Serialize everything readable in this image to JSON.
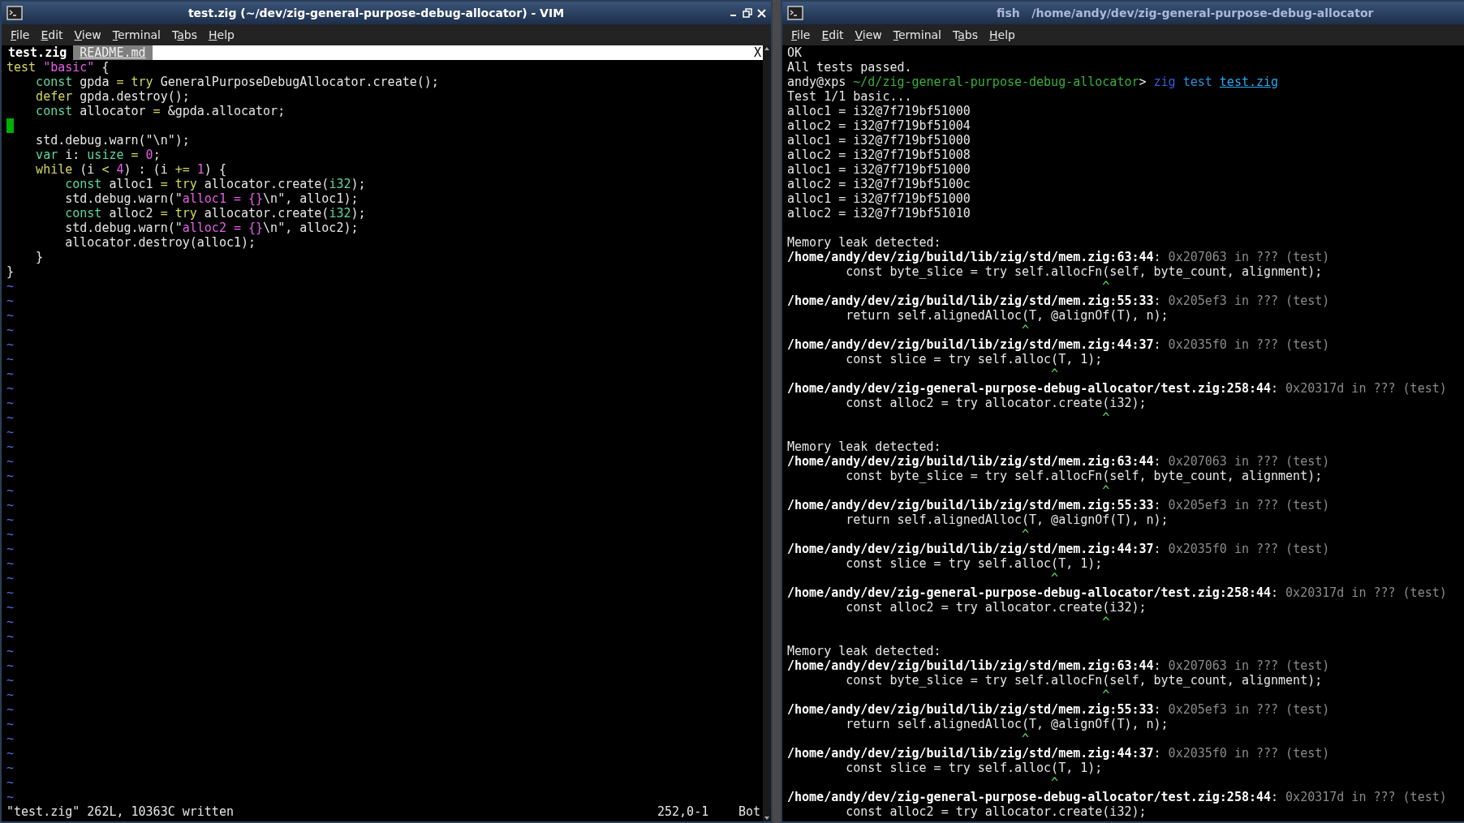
{
  "vim_window": {
    "title": "test.zig (~/dev/zig-general-purpose-debug-allocator) - VIM",
    "menu": [
      {
        "key": "F",
        "post": "ile"
      },
      {
        "key": "E",
        "post": "dit"
      },
      {
        "key": "V",
        "post": "iew"
      },
      {
        "key": "T",
        "post": "erminal"
      },
      {
        "pre": "T",
        "key": "a",
        "post": "bs"
      },
      {
        "key": "H",
        "post": "elp"
      }
    ],
    "tabs": [
      {
        "label": "test.zig",
        "selected": true
      },
      {
        "label": "README.md",
        "selected": false
      }
    ],
    "close_tab": "X",
    "lines": [
      {
        "kind": "text",
        "segs": [
          {
            "t": "test",
            "kind": "kw"
          },
          {
            "t": " \"basic\"",
            "kind": "lit"
          },
          {
            "t": " {",
            "kind": "plain"
          }
        ]
      },
      {
        "kind": "text",
        "segs": [
          {
            "t": "    const",
            "kind": "decl"
          },
          {
            "t": " gpda",
            "kind": "plain"
          },
          {
            "t": " =",
            "kind": "kw"
          },
          {
            "t": " try",
            "kind": "kw"
          },
          {
            "t": " GeneralPurposeDebugAllocator.create();",
            "kind": "plain"
          }
        ]
      },
      {
        "kind": "text",
        "segs": [
          {
            "t": "    defer",
            "kind": "kw"
          },
          {
            "t": " gpda.destroy();",
            "kind": "plain"
          }
        ]
      },
      {
        "kind": "text",
        "segs": [
          {
            "t": "    const",
            "kind": "decl"
          },
          {
            "t": " allocator",
            "kind": "plain"
          },
          {
            "t": " =",
            "kind": "kw"
          },
          {
            "t": " &gpda.allocator;",
            "kind": "plain"
          }
        ]
      },
      {
        "kind": "cursor"
      },
      {
        "kind": "text",
        "segs": [
          {
            "t": "    std.debug.warn(\"\\n\");",
            "kind": "plain"
          }
        ]
      },
      {
        "kind": "text",
        "segs": [
          {
            "t": "    var",
            "kind": "decl"
          },
          {
            "t": " i:",
            "kind": "plain"
          },
          {
            "t": " usize",
            "kind": "decl"
          },
          {
            "t": " =",
            "kind": "kw"
          },
          {
            "t": " 0",
            "kind": "lit"
          },
          {
            "t": ";",
            "kind": "plain"
          }
        ]
      },
      {
        "kind": "text",
        "segs": [
          {
            "t": "    while",
            "kind": "kw"
          },
          {
            "t": " (i",
            "kind": "plain"
          },
          {
            "t": " <",
            "kind": "kw"
          },
          {
            "t": " 4",
            "kind": "lit"
          },
          {
            "t": ") : (i",
            "kind": "plain"
          },
          {
            "t": " +=",
            "kind": "kw"
          },
          {
            "t": " 1",
            "kind": "lit"
          },
          {
            "t": ") {",
            "kind": "plain"
          }
        ]
      },
      {
        "kind": "text",
        "segs": [
          {
            "t": "        const",
            "kind": "decl"
          },
          {
            "t": " alloc1",
            "kind": "plain"
          },
          {
            "t": " =",
            "kind": "kw"
          },
          {
            "t": " try",
            "kind": "kw"
          },
          {
            "t": " allocator.create(",
            "kind": "plain"
          },
          {
            "t": "i32",
            "kind": "decl"
          },
          {
            "t": ");",
            "kind": "plain"
          }
        ]
      },
      {
        "kind": "text",
        "segs": [
          {
            "t": "        std.debug.warn(\"",
            "kind": "plain"
          },
          {
            "t": "alloc1 = {}",
            "kind": "lit"
          },
          {
            "t": "\\n\", alloc1);",
            "kind": "plain"
          }
        ]
      },
      {
        "kind": "text",
        "segs": [
          {
            "t": "        const",
            "kind": "decl"
          },
          {
            "t": " alloc2",
            "kind": "plain"
          },
          {
            "t": " =",
            "kind": "kw"
          },
          {
            "t": " try",
            "kind": "kw"
          },
          {
            "t": " allocator.create(",
            "kind": "plain"
          },
          {
            "t": "i32",
            "kind": "decl"
          },
          {
            "t": ");",
            "kind": "plain"
          }
        ]
      },
      {
        "kind": "text",
        "segs": [
          {
            "t": "        std.debug.warn(\"",
            "kind": "plain"
          },
          {
            "t": "alloc2 = {}",
            "kind": "lit"
          },
          {
            "t": "\\n\", alloc2);",
            "kind": "plain"
          }
        ]
      },
      {
        "kind": "text",
        "segs": [
          {
            "t": "        allocator.destroy(alloc1);",
            "kind": "plain"
          }
        ]
      },
      {
        "kind": "text",
        "segs": [
          {
            "t": "    }",
            "kind": "plain"
          }
        ]
      },
      {
        "kind": "text",
        "segs": [
          {
            "t": "}",
            "kind": "plain"
          }
        ]
      }
    ],
    "tildes": [
      "~",
      "~",
      "~",
      "~",
      "~",
      "~",
      "~",
      "~",
      "~",
      "~",
      "~",
      "~",
      "~",
      "~",
      "~",
      "~",
      "~",
      "~",
      "~",
      "~",
      "~",
      "~",
      "~",
      "~",
      "~",
      "~",
      "~",
      "~",
      "~",
      "~",
      "~",
      "~",
      "~",
      "~",
      "~",
      "~"
    ],
    "status": {
      "message": "\"test.zig\" 262L, 10363C written",
      "position": "252,0-1",
      "scroll": "Bot"
    }
  },
  "terminal_window": {
    "title": "fish   /home/andy/dev/zig-general-purpose-debug-allocator",
    "menu": [
      {
        "key": "F",
        "post": "ile"
      },
      {
        "key": "E",
        "post": "dit"
      },
      {
        "key": "V",
        "post": "iew"
      },
      {
        "key": "T",
        "post": "erminal"
      },
      {
        "pre": "T",
        "key": "a",
        "post": "bs"
      },
      {
        "key": "H",
        "post": "elp"
      }
    ],
    "lines": [
      {
        "kind": "text",
        "segs": [
          {
            "t": "OK",
            "kind": "plain"
          }
        ]
      },
      {
        "kind": "text",
        "segs": [
          {
            "t": "All tests passed.",
            "kind": "plain"
          }
        ]
      },
      {
        "kind": "text",
        "segs": [
          {
            "t": "andy@xps",
            "kind": "plain"
          },
          {
            "t": " ~/d/zig-general-purpose-debug-allocator",
            "kind": "green"
          },
          {
            "t": ">",
            "kind": "plain"
          },
          {
            "t": " zig",
            "kind": "blue"
          },
          {
            "t": " test ",
            "kind": "cyan"
          },
          {
            "t": "test.zig",
            "kind": "link"
          }
        ]
      },
      {
        "kind": "text",
        "segs": [
          {
            "t": "Test 1/1 basic...",
            "kind": "plain"
          }
        ]
      },
      {
        "kind": "text",
        "segs": [
          {
            "t": "alloc1 = i32@7f719bf51000",
            "kind": "plain"
          }
        ]
      },
      {
        "kind": "text",
        "segs": [
          {
            "t": "alloc2 = i32@7f719bf51004",
            "kind": "plain"
          }
        ]
      },
      {
        "kind": "text",
        "segs": [
          {
            "t": "alloc1 = i32@7f719bf51000",
            "kind": "plain"
          }
        ]
      },
      {
        "kind": "text",
        "segs": [
          {
            "t": "alloc2 = i32@7f719bf51008",
            "kind": "plain"
          }
        ]
      },
      {
        "kind": "text",
        "segs": [
          {
            "t": "alloc1 = i32@7f719bf51000",
            "kind": "plain"
          }
        ]
      },
      {
        "kind": "text",
        "segs": [
          {
            "t": "alloc2 = i32@7f719bf5100c",
            "kind": "plain"
          }
        ]
      },
      {
        "kind": "text",
        "segs": [
          {
            "t": "alloc1 = i32@7f719bf51000",
            "kind": "plain"
          }
        ]
      },
      {
        "kind": "text",
        "segs": [
          {
            "t": "alloc2 = i32@7f719bf51010",
            "kind": "plain"
          }
        ]
      },
      {
        "kind": "blank"
      },
      {
        "kind": "text",
        "segs": [
          {
            "t": "Memory leak detected:",
            "kind": "plain"
          }
        ]
      },
      {
        "kind": "text",
        "segs": [
          {
            "t": "/home/andy/dev/zig/build/lib/zig/std/mem.zig:63:44",
            "kind": "bold"
          },
          {
            "t": ":",
            "kind": "plain"
          },
          {
            "t": " 0x207063 in ??? (test)",
            "kind": "dim"
          }
        ]
      },
      {
        "kind": "text",
        "segs": [
          {
            "t": "        const byte_slice = try self.allocFn(self, byte_count, alignment);",
            "kind": "plain"
          }
        ]
      },
      {
        "kind": "text",
        "segs": [
          {
            "t": "                                           ^",
            "kind": "caret"
          }
        ]
      },
      {
        "kind": "text",
        "segs": [
          {
            "t": "/home/andy/dev/zig/build/lib/zig/std/mem.zig:55:33",
            "kind": "bold"
          },
          {
            "t": ":",
            "kind": "plain"
          },
          {
            "t": " 0x205ef3 in ??? (test)",
            "kind": "dim"
          }
        ]
      },
      {
        "kind": "text",
        "segs": [
          {
            "t": "        return self.alignedAlloc(T, @alignOf(T), n);",
            "kind": "plain"
          }
        ]
      },
      {
        "kind": "text",
        "segs": [
          {
            "t": "                                ^",
            "kind": "caret"
          }
        ]
      },
      {
        "kind": "text",
        "segs": [
          {
            "t": "/home/andy/dev/zig/build/lib/zig/std/mem.zig:44:37",
            "kind": "bold"
          },
          {
            "t": ":",
            "kind": "plain"
          },
          {
            "t": " 0x2035f0 in ??? (test)",
            "kind": "dim"
          }
        ]
      },
      {
        "kind": "text",
        "segs": [
          {
            "t": "        const slice = try self.alloc(T, 1);",
            "kind": "plain"
          }
        ]
      },
      {
        "kind": "text",
        "segs": [
          {
            "t": "                                    ^",
            "kind": "caret"
          }
        ]
      },
      {
        "kind": "text",
        "segs": [
          {
            "t": "/home/andy/dev/zig-general-purpose-debug-allocator/test.zig:258:44",
            "kind": "bold"
          },
          {
            "t": ":",
            "kind": "plain"
          },
          {
            "t": " 0x20317d in ??? (test)",
            "kind": "dim"
          }
        ]
      },
      {
        "kind": "text",
        "segs": [
          {
            "t": "        const alloc2 = try allocator.create(i32);",
            "kind": "plain"
          }
        ]
      },
      {
        "kind": "text",
        "segs": [
          {
            "t": "                                           ^",
            "kind": "caret"
          }
        ]
      },
      {
        "kind": "blank"
      },
      {
        "kind": "text",
        "segs": [
          {
            "t": "Memory leak detected:",
            "kind": "plain"
          }
        ]
      },
      {
        "kind": "text",
        "segs": [
          {
            "t": "/home/andy/dev/zig/build/lib/zig/std/mem.zig:63:44",
            "kind": "bold"
          },
          {
            "t": ":",
            "kind": "plain"
          },
          {
            "t": " 0x207063 in ??? (test)",
            "kind": "dim"
          }
        ]
      },
      {
        "kind": "text",
        "segs": [
          {
            "t": "        const byte_slice = try self.allocFn(self, byte_count, alignment);",
            "kind": "plain"
          }
        ]
      },
      {
        "kind": "text",
        "segs": [
          {
            "t": "                                           ^",
            "kind": "caret"
          }
        ]
      },
      {
        "kind": "text",
        "segs": [
          {
            "t": "/home/andy/dev/zig/build/lib/zig/std/mem.zig:55:33",
            "kind": "bold"
          },
          {
            "t": ":",
            "kind": "plain"
          },
          {
            "t": " 0x205ef3 in ??? (test)",
            "kind": "dim"
          }
        ]
      },
      {
        "kind": "text",
        "segs": [
          {
            "t": "        return self.alignedAlloc(T, @alignOf(T), n);",
            "kind": "plain"
          }
        ]
      },
      {
        "kind": "text",
        "segs": [
          {
            "t": "                                ^",
            "kind": "caret"
          }
        ]
      },
      {
        "kind": "text",
        "segs": [
          {
            "t": "/home/andy/dev/zig/build/lib/zig/std/mem.zig:44:37",
            "kind": "bold"
          },
          {
            "t": ":",
            "kind": "plain"
          },
          {
            "t": " 0x2035f0 in ??? (test)",
            "kind": "dim"
          }
        ]
      },
      {
        "kind": "text",
        "segs": [
          {
            "t": "        const slice = try self.alloc(T, 1);",
            "kind": "plain"
          }
        ]
      },
      {
        "kind": "text",
        "segs": [
          {
            "t": "                                    ^",
            "kind": "caret"
          }
        ]
      },
      {
        "kind": "text",
        "segs": [
          {
            "t": "/home/andy/dev/zig-general-purpose-debug-allocator/test.zig:258:44",
            "kind": "bold"
          },
          {
            "t": ":",
            "kind": "plain"
          },
          {
            "t": " 0x20317d in ??? (test)",
            "kind": "dim"
          }
        ]
      },
      {
        "kind": "text",
        "segs": [
          {
            "t": "        const alloc2 = try allocator.create(i32);",
            "kind": "plain"
          }
        ]
      },
      {
        "kind": "text",
        "segs": [
          {
            "t": "                                           ^",
            "kind": "caret"
          }
        ]
      },
      {
        "kind": "blank"
      },
      {
        "kind": "text",
        "segs": [
          {
            "t": "Memory leak detected:",
            "kind": "plain"
          }
        ]
      },
      {
        "kind": "text",
        "segs": [
          {
            "t": "/home/andy/dev/zig/build/lib/zig/std/mem.zig:63:44",
            "kind": "bold"
          },
          {
            "t": ":",
            "kind": "plain"
          },
          {
            "t": " 0x207063 in ??? (test)",
            "kind": "dim"
          }
        ]
      },
      {
        "kind": "text",
        "segs": [
          {
            "t": "        const byte_slice = try self.allocFn(self, byte_count, alignment);",
            "kind": "plain"
          }
        ]
      },
      {
        "kind": "text",
        "segs": [
          {
            "t": "                                           ^",
            "kind": "caret"
          }
        ]
      },
      {
        "kind": "text",
        "segs": [
          {
            "t": "/home/andy/dev/zig/build/lib/zig/std/mem.zig:55:33",
            "kind": "bold"
          },
          {
            "t": ":",
            "kind": "plain"
          },
          {
            "t": " 0x205ef3 in ??? (test)",
            "kind": "dim"
          }
        ]
      },
      {
        "kind": "text",
        "segs": [
          {
            "t": "        return self.alignedAlloc(T, @alignOf(T), n);",
            "kind": "plain"
          }
        ]
      },
      {
        "kind": "text",
        "segs": [
          {
            "t": "                                ^",
            "kind": "caret"
          }
        ]
      },
      {
        "kind": "text",
        "segs": [
          {
            "t": "/home/andy/dev/zig/build/lib/zig/std/mem.zig:44:37",
            "kind": "bold"
          },
          {
            "t": ":",
            "kind": "plain"
          },
          {
            "t": " 0x2035f0 in ??? (test)",
            "kind": "dim"
          }
        ]
      },
      {
        "kind": "text",
        "segs": [
          {
            "t": "        const slice = try self.alloc(T, 1);",
            "kind": "plain"
          }
        ]
      },
      {
        "kind": "text",
        "segs": [
          {
            "t": "                                    ^",
            "kind": "caret"
          }
        ]
      },
      {
        "kind": "text",
        "segs": [
          {
            "t": "/home/andy/dev/zig-general-purpose-debug-allocator/test.zig:258:44",
            "kind": "bold"
          },
          {
            "t": ":",
            "kind": "plain"
          },
          {
            "t": " 0x20317d in ??? (test)",
            "kind": "dim"
          }
        ]
      },
      {
        "kind": "text",
        "segs": [
          {
            "t": "        const alloc2 = try allocator.create(i32);",
            "kind": "plain"
          }
        ]
      }
    ]
  }
}
